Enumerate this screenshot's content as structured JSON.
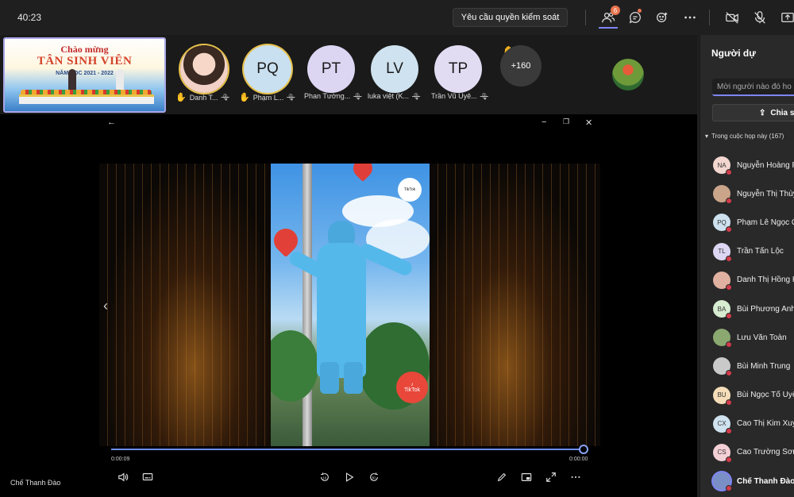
{
  "topbar": {
    "clock": "40:23",
    "request_control_label": "Yêu cầu quyền kiểm soát",
    "people_badge": "6"
  },
  "strip": {
    "slide": {
      "title_line1": "Chào mừng",
      "title_line2": "TÂN SINH VIÊN",
      "year": "NĂM HỌC 2021 - 2022"
    },
    "participants": [
      {
        "initials": "",
        "label": "Danh T...",
        "hand": true,
        "color": "#f2d2c6"
      },
      {
        "initials": "PQ",
        "label": "Phạm L...",
        "hand": true,
        "color": "#c9e0f0"
      },
      {
        "initials": "PT",
        "label": "Phan Tường...",
        "hand": false,
        "color": "#dcd6f3"
      },
      {
        "initials": "LV",
        "label": "luka việt (K...",
        "hand": false,
        "color": "#cfe2ef"
      },
      {
        "initials": "TP",
        "label": "Trần Vũ Uyê...",
        "hand": false,
        "color": "#e2dcf3"
      }
    ],
    "more_count": "+160"
  },
  "player": {
    "current_time": "0:00:09",
    "end_time": "0:00:00",
    "progress": 1.0,
    "presenter": "Chế Thanh Đào",
    "overlay_texts": [
      "TikTok"
    ]
  },
  "panel": {
    "title": "Người dự",
    "invite_placeholder": "Mời người nào đó ho",
    "share_label": "Chia s",
    "section_label": "Trong cuộc họp này (167)",
    "people": [
      {
        "initials": "NA",
        "name": "Nguyễn Hoàng P",
        "color": "#f3d6d0"
      },
      {
        "initials": "",
        "name": "Nguyễn Thị Thùy",
        "color": "#caa58a"
      },
      {
        "initials": "PQ",
        "name": "Phạm Lê Ngọc Q",
        "color": "#cde1ee"
      },
      {
        "initials": "TL",
        "name": "Trần Tấn Lộc",
        "color": "#ddd6f3"
      },
      {
        "initials": "",
        "name": "Danh Thị Hồng H",
        "color": "#e0b0a0"
      },
      {
        "initials": "BA",
        "name": "Bùi Phương Anh",
        "color": "#d7ecd0"
      },
      {
        "initials": "",
        "name": "Lưu Văn Toàn",
        "color": "#8aa870"
      },
      {
        "initials": "",
        "name": "Bùi Minh Trung",
        "color": "#c9c9c9"
      },
      {
        "initials": "BU",
        "name": "Bùi Ngọc Tố Uyê",
        "color": "#f4ddb8"
      },
      {
        "initials": "CX",
        "name": "Cao Thị Kim Xuy",
        "color": "#cfe2ef"
      },
      {
        "initials": "CS",
        "name": "Cao Trường Sơn",
        "color": "#f3d0d6"
      },
      {
        "initials": "",
        "name": "Chế Thanh Đào",
        "color": "#7b8fc7"
      }
    ]
  }
}
